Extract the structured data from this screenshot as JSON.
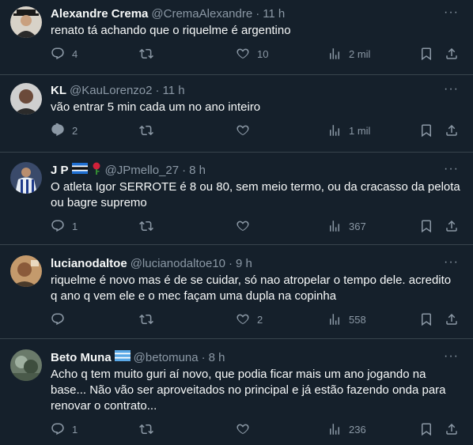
{
  "tweets": [
    {
      "name": "Alexandre Crema",
      "handle": "@CremaAlexandre",
      "time": "11 h",
      "text": "renato tá achando que o riquelme é argentino",
      "replies": "4",
      "retweets": "",
      "likes": "10",
      "views": "2 mil"
    },
    {
      "name": "KL",
      "handle": "@KauLorenzo2",
      "time": "11 h",
      "text": "vão entrar 5 min cada um no ano inteiro",
      "replies": "2",
      "retweets": "",
      "likes": "",
      "views": "1 mil"
    },
    {
      "name": "J P",
      "handle": "@JPmello_27",
      "time": "8 h",
      "text": "O atleta Igor SERROTE é 8 ou 80, sem meio termo, ou da cracasso da pelota\nou bagre supremo",
      "replies": "1",
      "retweets": "",
      "likes": "",
      "views": "367"
    },
    {
      "name": "lucianodaltoe",
      "handle": "@lucianodaltoe10",
      "time": "9 h",
      "text": "riquelme é novo mas é de se cuidar, só nao atropelar o tempo dele. acredito\nq ano q vem ele e o mec façam uma dupla na copinha",
      "replies": "",
      "retweets": "",
      "likes": "2",
      "views": "558"
    },
    {
      "name": "Beto Muna",
      "handle": "@betomuna",
      "time": "8 h",
      "text": "Acho q tem muito guri aí novo, que podia ficar mais um ano jogando na\nbase... Não vão ser aproveitados no principal e já estão fazendo onda para\nrenovar o contrato...",
      "replies": "1",
      "retweets": "",
      "likes": "",
      "views": "236"
    }
  ],
  "dot": "·",
  "more": "···",
  "colors": {
    "background": "#15202b",
    "divider": "#38444d",
    "secondary_text": "#8b98a5",
    "primary_text": "#f7f9f9"
  },
  "icons": [
    "reply-icon",
    "retweet-icon",
    "like-icon",
    "views-icon",
    "bookmark-icon",
    "share-icon",
    "more-icon"
  ]
}
